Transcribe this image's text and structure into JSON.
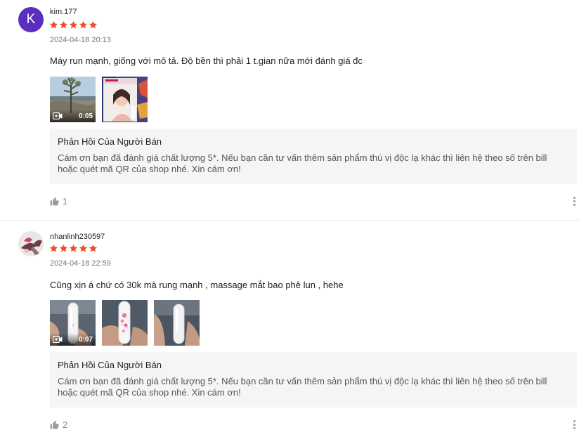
{
  "reviews": [
    {
      "avatar_letter": "K",
      "username": "kim.177",
      "rating": 5,
      "time": "2024-04-18 20:13",
      "comment": "Máy run mạnh, giống với mô tả. Độ bền thì phải 1 t.gian nữa mới đánh giá đc",
      "video_duration": "0:05",
      "reply_title": "Phản Hồi Của Người Bán",
      "reply_text": "Cám ơn bạn đã đánh giá chất lượng 5*. Nếu bạn cần tư vấn thêm sản phẩm thú vị độc lạ khác thì liên hệ theo số trên bill hoặc quét mã QR của shop nhé. Xin cám ơn!",
      "likes": "1"
    },
    {
      "username": "nhanlinh230597",
      "rating": 5,
      "time": "2024-04-18 22:59",
      "comment": "Cũng xịn á chứ có 30k mà rung mạnh , massage mắt bao phê lun , hehe",
      "video_duration": "0:07",
      "reply_title": "Phản Hồi Của Người Bán",
      "reply_text": "Cám ơn bạn đã đánh giá chất lượng 5*. Nếu bạn cần tư vấn thêm sản phẩm thú vị độc lạ khác thì liên hệ theo số trên bill hoặc quét mã QR của shop nhé. Xin cám ơn!",
      "likes": "2"
    }
  ],
  "colors": {
    "star": "#ee4d2d",
    "avatar_k": "#5b2ec0",
    "reply_bg": "#f5f5f5"
  },
  "icons": [
    "star-icon",
    "video-camera-icon",
    "thumbs-up-icon",
    "more-options-icon"
  ]
}
